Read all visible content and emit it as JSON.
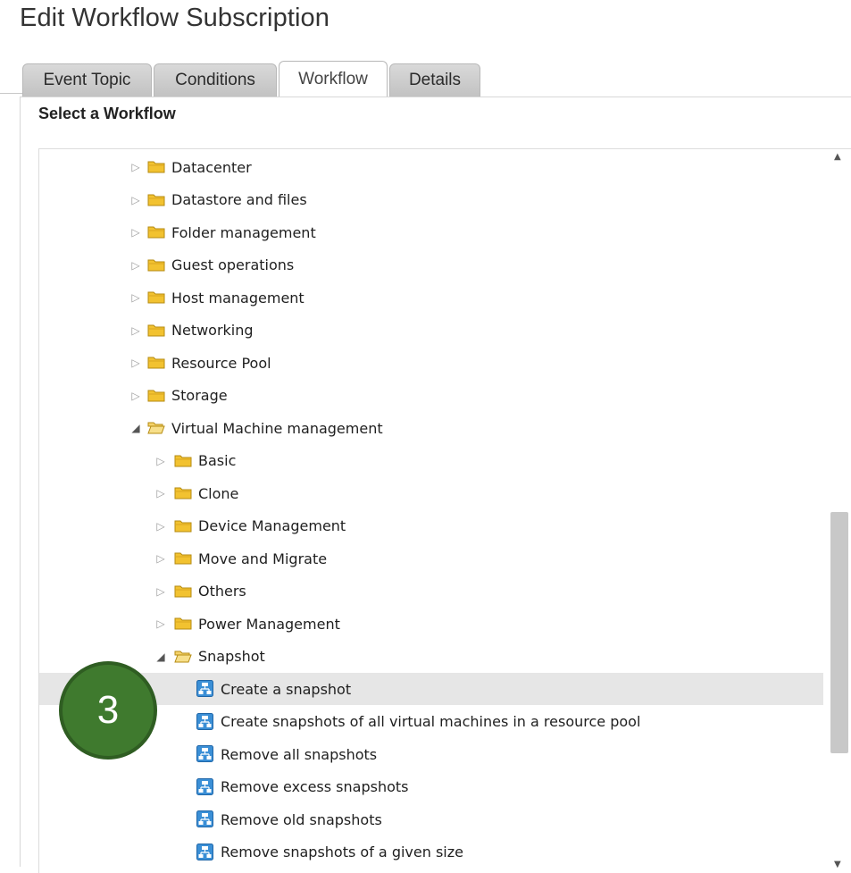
{
  "page": {
    "title": "Edit Workflow Subscription"
  },
  "tabs": [
    {
      "label": "Event Topic",
      "active": false
    },
    {
      "label": "Conditions",
      "active": false
    },
    {
      "label": "Workflow",
      "active": true
    },
    {
      "label": "Details",
      "active": false
    }
  ],
  "section": {
    "label": "Select a Workflow"
  },
  "tree": {
    "items": [
      {
        "label": "Datacenter",
        "type": "folder",
        "level": 0,
        "expanded": false
      },
      {
        "label": "Datastore and files",
        "type": "folder",
        "level": 0,
        "expanded": false
      },
      {
        "label": "Folder management",
        "type": "folder",
        "level": 0,
        "expanded": false
      },
      {
        "label": "Guest operations",
        "type": "folder",
        "level": 0,
        "expanded": false
      },
      {
        "label": "Host management",
        "type": "folder",
        "level": 0,
        "expanded": false
      },
      {
        "label": "Networking",
        "type": "folder",
        "level": 0,
        "expanded": false
      },
      {
        "label": "Resource Pool",
        "type": "folder",
        "level": 0,
        "expanded": false
      },
      {
        "label": "Storage",
        "type": "folder",
        "level": 0,
        "expanded": false
      },
      {
        "label": "Virtual Machine management",
        "type": "folder",
        "level": 0,
        "expanded": true
      },
      {
        "label": "Basic",
        "type": "folder",
        "level": 1,
        "expanded": false
      },
      {
        "label": "Clone",
        "type": "folder",
        "level": 1,
        "expanded": false
      },
      {
        "label": "Device Management",
        "type": "folder",
        "level": 1,
        "expanded": false
      },
      {
        "label": "Move and Migrate",
        "type": "folder",
        "level": 1,
        "expanded": false
      },
      {
        "label": "Others",
        "type": "folder",
        "level": 1,
        "expanded": false
      },
      {
        "label": "Power Management",
        "type": "folder",
        "level": 1,
        "expanded": false
      },
      {
        "label": "Snapshot",
        "type": "folder",
        "level": 1,
        "expanded": true
      },
      {
        "label": "Create a snapshot",
        "type": "workflow",
        "level": 2,
        "selected": true
      },
      {
        "label": "Create snapshots of all virtual machines in a resource pool",
        "type": "workflow",
        "level": 2
      },
      {
        "label": "Remove all snapshots",
        "type": "workflow",
        "level": 2
      },
      {
        "label": "Remove excess snapshots",
        "type": "workflow",
        "level": 2
      },
      {
        "label": "Remove old snapshots",
        "type": "workflow",
        "level": 2
      },
      {
        "label": "Remove snapshots of a given size",
        "type": "workflow",
        "level": 2
      }
    ]
  },
  "annotation": {
    "step_number": "3"
  },
  "colors": {
    "badge": "#3f7a2e",
    "folder": "#f2c230",
    "workflow_icon": "#3b8fd6",
    "selected_row": "#e6e6e6"
  },
  "icons": {
    "folder": "folder-icon",
    "workflow": "workflow-icon",
    "collapsed": "triangle-right-icon",
    "expanded": "triangle-down-icon"
  }
}
